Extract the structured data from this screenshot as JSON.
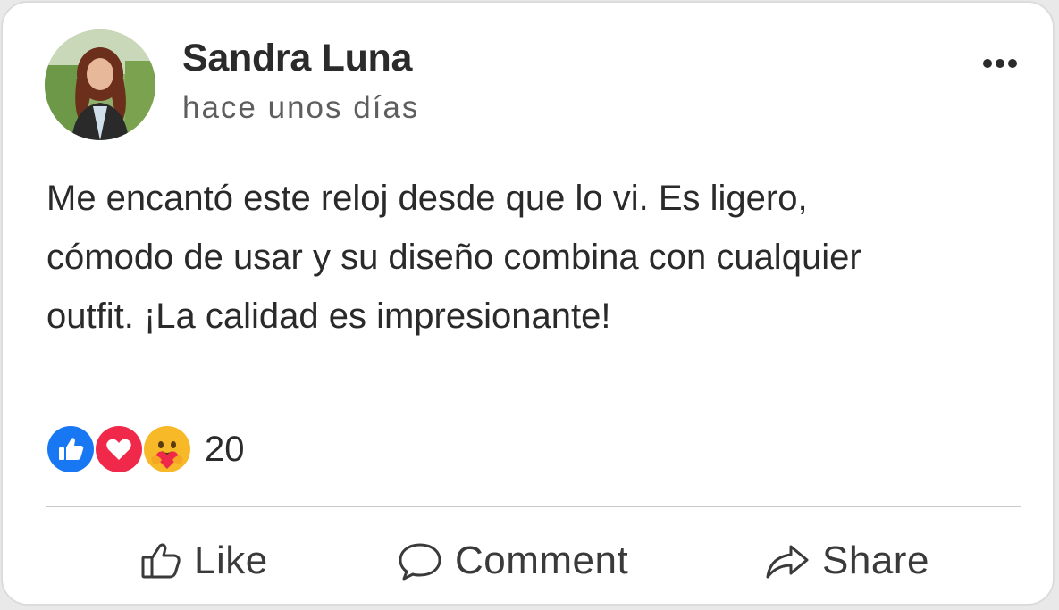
{
  "post": {
    "author_name": "Sandra Luna",
    "timestamp": "hace unos días",
    "avatar_icon": "avatar-photo",
    "more_icon": "more-horizontal-icon",
    "text_lines": [
      "Me encantó este reloj desde que lo vi. Es ligero,",
      "cómodo de usar y su diseño combina con cualquier",
      "outfit. ¡La calidad es impresionante!"
    ]
  },
  "reactions": {
    "icons": [
      "like-reaction-icon",
      "love-reaction-icon",
      "care-reaction-icon"
    ],
    "count": "20",
    "colors": {
      "like": "#1877f2",
      "love": "#f0284a",
      "care": "#f7b928"
    }
  },
  "actions": {
    "like_label": "Like",
    "comment_label": "Comment",
    "share_label": "Share"
  }
}
